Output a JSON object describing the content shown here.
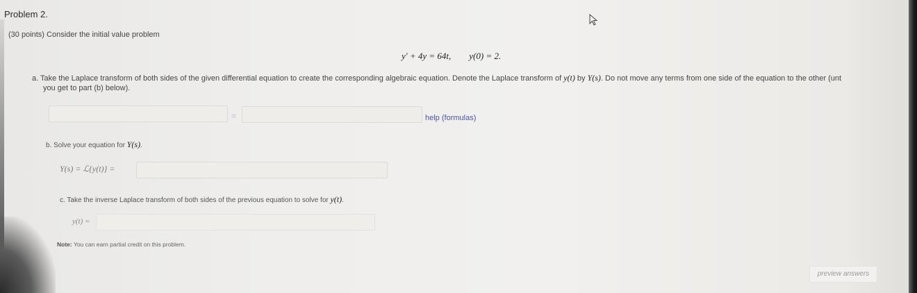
{
  "problem": {
    "title": "Problem 2.",
    "intro": "(30 points) Consider the initial value problem",
    "equation": "y′ + 4y = 64t,        y(0) = 2."
  },
  "part_a": {
    "text_1": "a. Take the Laplace transform of both sides of the given differential equation to create the corresponding algebraic equation. Denote the Laplace transform of ",
    "y_of_t": "y(t)",
    "by": " by ",
    "Y_of_s": "Y(s)",
    "text_2": ". Do not move any terms from one side of the equation to the other (unt",
    "line_2": "you get to part (b) below).",
    "eq_sign": "=",
    "help_link": "help (formulas)"
  },
  "part_b": {
    "text": "b. Solve your equation for ",
    "Y_of_s": "Y(s)",
    "end": ".",
    "equation_label": "Y(s) = ℒ{y(t)} ="
  },
  "part_c": {
    "text": "c. Take the inverse Laplace transform of both sides of the previous equation to solve for ",
    "y_of_t": "y(t)",
    "end": ".",
    "equation_label": "y(t) ="
  },
  "note": {
    "label": "Note:",
    "text": " You can earn partial credit on this problem."
  },
  "preview_button": "preview answers",
  "colors": {
    "link": "#4a55a0",
    "background": "#f0efed"
  }
}
